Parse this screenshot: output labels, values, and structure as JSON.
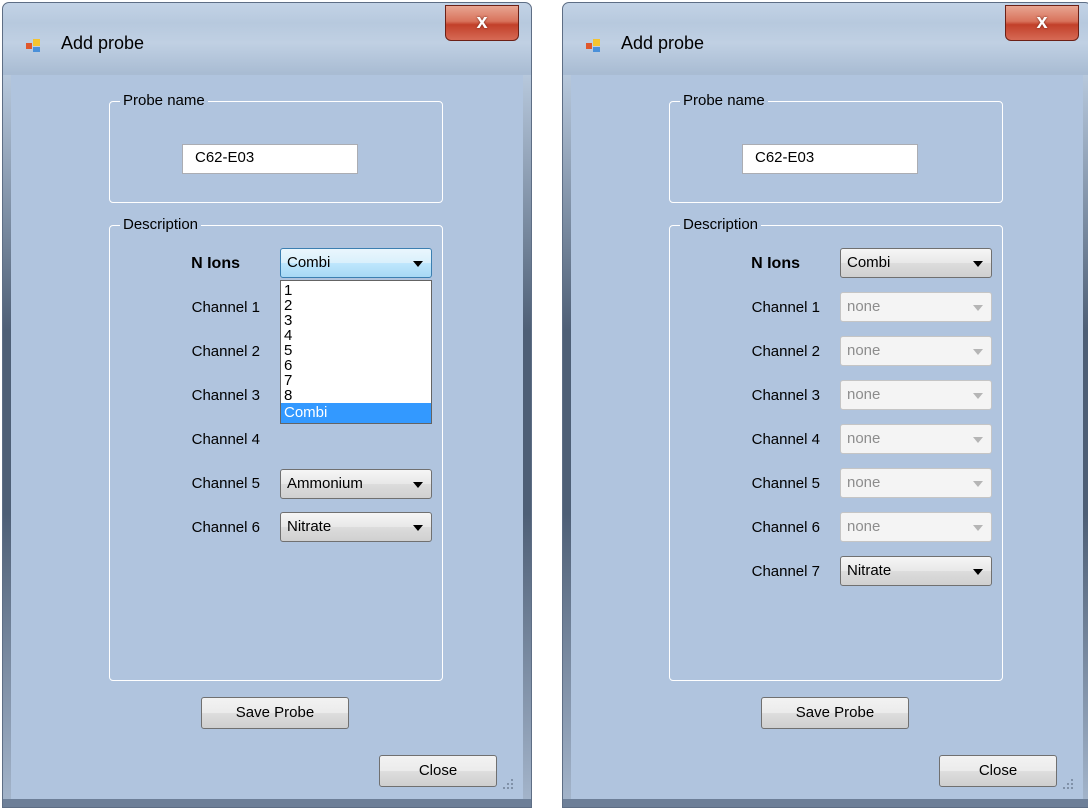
{
  "left": {
    "title": "Add probe",
    "close_glyph": "x",
    "probe_group_label": "Probe name",
    "probe_name_value": "C62-E03",
    "description_label": "Description",
    "n_ions_label": "N Ions",
    "n_ions_value": "Combi",
    "channels": [
      {
        "label": "Channel 1",
        "value": ""
      },
      {
        "label": "Channel 2",
        "value": ""
      },
      {
        "label": "Channel 3",
        "value": ""
      },
      {
        "label": "Channel 4",
        "value": ""
      },
      {
        "label": "Channel 5",
        "value": "Ammonium"
      },
      {
        "label": "Channel 6",
        "value": "Nitrate"
      }
    ],
    "dropdown_options": [
      "1",
      "2",
      "3",
      "4",
      "5",
      "6",
      "7",
      "8",
      "Combi"
    ],
    "save_label": "Save Probe",
    "close_label": "Close"
  },
  "right": {
    "title": "Add probe",
    "close_glyph": "x",
    "probe_group_label": "Probe name",
    "probe_name_value": "C62-E03",
    "description_label": "Description",
    "n_ions_label": "N Ions",
    "n_ions_value": "Combi",
    "channels": [
      {
        "label": "Channel 1",
        "value": "none"
      },
      {
        "label": "Channel 2",
        "value": "none"
      },
      {
        "label": "Channel 3",
        "value": "none"
      },
      {
        "label": "Channel 4",
        "value": "none"
      },
      {
        "label": "Channel 5",
        "value": "none"
      },
      {
        "label": "Channel 6",
        "value": "none"
      },
      {
        "label": "Channel 7",
        "value": "Nitrate"
      }
    ],
    "save_label": "Save Probe",
    "close_label": "Close"
  },
  "colors": {
    "client_bg": "#b0c4de",
    "selection": "#3399ff",
    "close_button": "#c2402a"
  },
  "icons": {
    "title_icon": "app-form-icon",
    "close": "close-x-icon",
    "combo_arrow": "chevron-down-icon",
    "resize": "resize-grip-icon"
  }
}
